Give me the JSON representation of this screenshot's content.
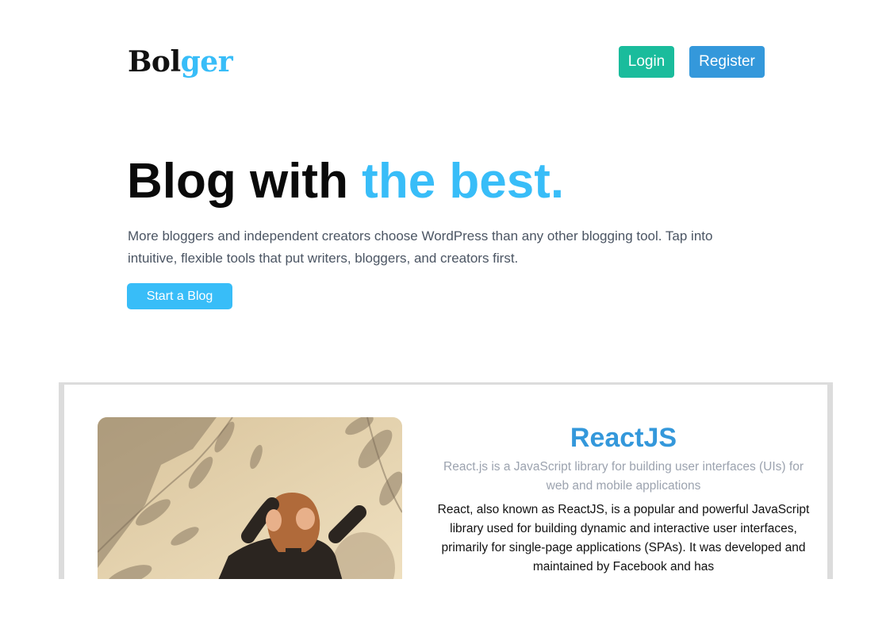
{
  "header": {
    "logo_part1": "Bol",
    "logo_part2": "ger",
    "login_label": "Login",
    "register_label": "Register"
  },
  "hero": {
    "title_part1": "Blog with ",
    "title_part2": "the best.",
    "description": "More bloggers and independent creators choose WordPress than any other blogging tool. Tap into intuitive, flexible tools that put writers, bloggers, and creators first.",
    "cta_label": "Start a Blog"
  },
  "card": {
    "image_icon": "photo-woman-shadows",
    "title": "ReactJS",
    "subtitle": "React.js is a JavaScript library for building user interfaces (UIs) for web and mobile applications",
    "body": "React, also known as ReactJS, is a popular and powerful JavaScript library used for building dynamic and interactive user interfaces, primarily for single-page applications (SPAs). It was developed and maintained by Facebook and has"
  },
  "colors": {
    "accent": "#38bdf8",
    "login": "#1abc9c",
    "register": "#3498db",
    "card_title": "#3498db"
  }
}
